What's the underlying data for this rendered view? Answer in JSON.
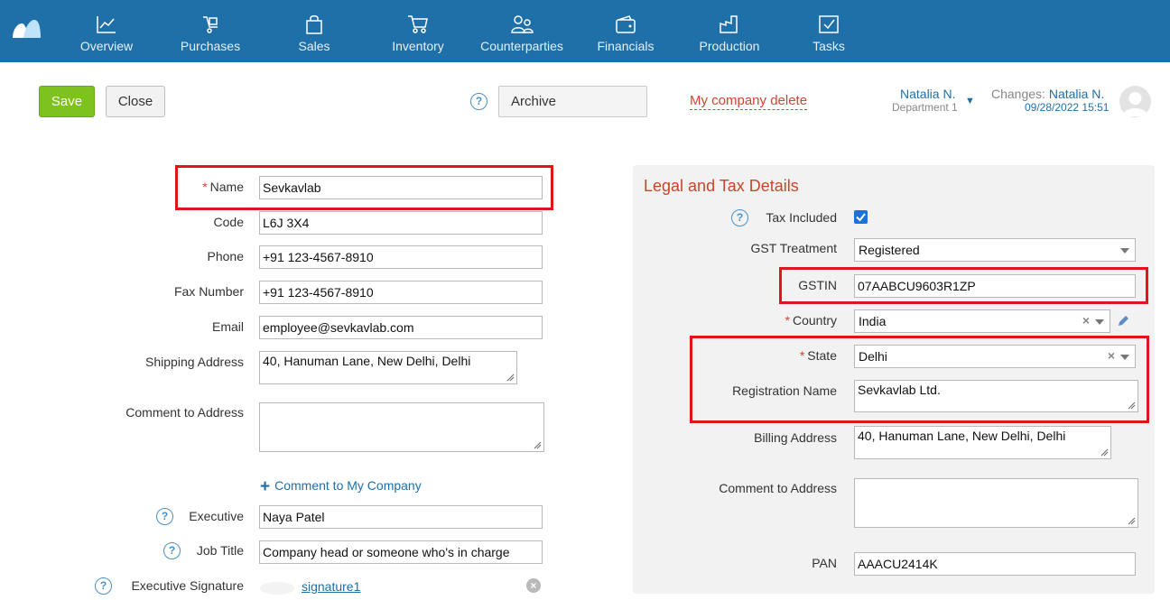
{
  "nav": {
    "items": [
      {
        "label": "Overview",
        "icon": "chart-icon"
      },
      {
        "label": "Purchases",
        "icon": "purchases-icon"
      },
      {
        "label": "Sales",
        "icon": "bag-icon"
      },
      {
        "label": "Inventory",
        "icon": "cart-icon"
      },
      {
        "label": "Counterparties",
        "icon": "people-icon"
      },
      {
        "label": "Financials",
        "icon": "wallet-icon"
      },
      {
        "label": "Production",
        "icon": "factory-icon"
      },
      {
        "label": "Tasks",
        "icon": "task-check-icon"
      }
    ]
  },
  "toolbar": {
    "save_label": "Save",
    "close_label": "Close",
    "help_glyph": "?",
    "archive_label": "Archive",
    "delete_label": "My company delete"
  },
  "user": {
    "name": "Natalia N.",
    "department": "Department 1",
    "changes_label": "Changes:",
    "changes_user": "Natalia N.",
    "changes_date": "09/28/2022 15:51"
  },
  "form": {
    "name": {
      "label": "Name",
      "value": "Sevkavlab"
    },
    "code": {
      "label": "Code",
      "value": "L6J 3X4"
    },
    "phone": {
      "label": "Phone",
      "value": "+91 123-4567-8910"
    },
    "fax": {
      "label": "Fax Number",
      "value": "+91 123-4567-8910"
    },
    "email": {
      "label": "Email",
      "value": "employee@sevkavlab.com"
    },
    "shipping_address": {
      "label": "Shipping Address",
      "value": "40, Hanuman Lane, New Delhi, Delhi"
    },
    "comment_to_address": {
      "label": "Comment to Address",
      "value": ""
    },
    "comment_link": "Comment to My Company",
    "executive": {
      "label": "Executive",
      "value": "Naya Patel"
    },
    "job_title": {
      "label": "Job Title",
      "value": "Company head or someone who's in charge"
    },
    "executive_signature": {
      "label": "Executive Signature",
      "file": "signature1"
    }
  },
  "legal": {
    "title": "Legal and Tax Details",
    "tax_included": {
      "label": "Tax Included",
      "checked": true
    },
    "gst_treatment": {
      "label": "GST Treatment",
      "value": "Registered"
    },
    "gstin": {
      "label": "GSTIN",
      "value": "07AABCU9603R1ZP"
    },
    "country": {
      "label": "Country",
      "value": "India"
    },
    "state": {
      "label": "State",
      "value": "Delhi"
    },
    "registration_name": {
      "label": "Registration Name",
      "value": "Sevkavlab Ltd."
    },
    "billing_address": {
      "label": "Billing Address",
      "value": "40, Hanuman Lane, New Delhi, Delhi"
    },
    "comment_to_address": {
      "label": "Comment to Address",
      "value": ""
    },
    "pan": {
      "label": "PAN",
      "value": "AAACU2414K"
    }
  },
  "colors": {
    "nav_bg": "#1f6fa8",
    "save_green": "#7dc21e",
    "accent_red": "#c9452a",
    "highlight_red": "#e0141e",
    "link_blue": "#1f6fa8"
  }
}
